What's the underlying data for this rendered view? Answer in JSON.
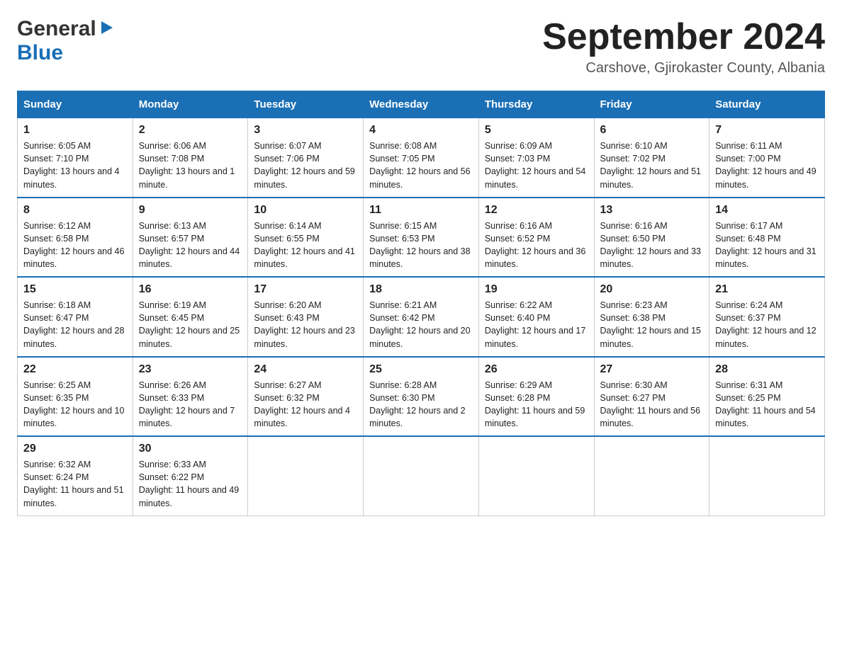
{
  "header": {
    "logo_general": "General",
    "logo_blue": "Blue",
    "month_title": "September 2024",
    "location": "Carshove, Gjirokaster County, Albania"
  },
  "days_of_week": [
    "Sunday",
    "Monday",
    "Tuesday",
    "Wednesday",
    "Thursday",
    "Friday",
    "Saturday"
  ],
  "weeks": [
    [
      {
        "day": "1",
        "sunrise": "6:05 AM",
        "sunset": "7:10 PM",
        "daylight": "13 hours and 4 minutes."
      },
      {
        "day": "2",
        "sunrise": "6:06 AM",
        "sunset": "7:08 PM",
        "daylight": "13 hours and 1 minute."
      },
      {
        "day": "3",
        "sunrise": "6:07 AM",
        "sunset": "7:06 PM",
        "daylight": "12 hours and 59 minutes."
      },
      {
        "day": "4",
        "sunrise": "6:08 AM",
        "sunset": "7:05 PM",
        "daylight": "12 hours and 56 minutes."
      },
      {
        "day": "5",
        "sunrise": "6:09 AM",
        "sunset": "7:03 PM",
        "daylight": "12 hours and 54 minutes."
      },
      {
        "day": "6",
        "sunrise": "6:10 AM",
        "sunset": "7:02 PM",
        "daylight": "12 hours and 51 minutes."
      },
      {
        "day": "7",
        "sunrise": "6:11 AM",
        "sunset": "7:00 PM",
        "daylight": "12 hours and 49 minutes."
      }
    ],
    [
      {
        "day": "8",
        "sunrise": "6:12 AM",
        "sunset": "6:58 PM",
        "daylight": "12 hours and 46 minutes."
      },
      {
        "day": "9",
        "sunrise": "6:13 AM",
        "sunset": "6:57 PM",
        "daylight": "12 hours and 44 minutes."
      },
      {
        "day": "10",
        "sunrise": "6:14 AM",
        "sunset": "6:55 PM",
        "daylight": "12 hours and 41 minutes."
      },
      {
        "day": "11",
        "sunrise": "6:15 AM",
        "sunset": "6:53 PM",
        "daylight": "12 hours and 38 minutes."
      },
      {
        "day": "12",
        "sunrise": "6:16 AM",
        "sunset": "6:52 PM",
        "daylight": "12 hours and 36 minutes."
      },
      {
        "day": "13",
        "sunrise": "6:16 AM",
        "sunset": "6:50 PM",
        "daylight": "12 hours and 33 minutes."
      },
      {
        "day": "14",
        "sunrise": "6:17 AM",
        "sunset": "6:48 PM",
        "daylight": "12 hours and 31 minutes."
      }
    ],
    [
      {
        "day": "15",
        "sunrise": "6:18 AM",
        "sunset": "6:47 PM",
        "daylight": "12 hours and 28 minutes."
      },
      {
        "day": "16",
        "sunrise": "6:19 AM",
        "sunset": "6:45 PM",
        "daylight": "12 hours and 25 minutes."
      },
      {
        "day": "17",
        "sunrise": "6:20 AM",
        "sunset": "6:43 PM",
        "daylight": "12 hours and 23 minutes."
      },
      {
        "day": "18",
        "sunrise": "6:21 AM",
        "sunset": "6:42 PM",
        "daylight": "12 hours and 20 minutes."
      },
      {
        "day": "19",
        "sunrise": "6:22 AM",
        "sunset": "6:40 PM",
        "daylight": "12 hours and 17 minutes."
      },
      {
        "day": "20",
        "sunrise": "6:23 AM",
        "sunset": "6:38 PM",
        "daylight": "12 hours and 15 minutes."
      },
      {
        "day": "21",
        "sunrise": "6:24 AM",
        "sunset": "6:37 PM",
        "daylight": "12 hours and 12 minutes."
      }
    ],
    [
      {
        "day": "22",
        "sunrise": "6:25 AM",
        "sunset": "6:35 PM",
        "daylight": "12 hours and 10 minutes."
      },
      {
        "day": "23",
        "sunrise": "6:26 AM",
        "sunset": "6:33 PM",
        "daylight": "12 hours and 7 minutes."
      },
      {
        "day": "24",
        "sunrise": "6:27 AM",
        "sunset": "6:32 PM",
        "daylight": "12 hours and 4 minutes."
      },
      {
        "day": "25",
        "sunrise": "6:28 AM",
        "sunset": "6:30 PM",
        "daylight": "12 hours and 2 minutes."
      },
      {
        "day": "26",
        "sunrise": "6:29 AM",
        "sunset": "6:28 PM",
        "daylight": "11 hours and 59 minutes."
      },
      {
        "day": "27",
        "sunrise": "6:30 AM",
        "sunset": "6:27 PM",
        "daylight": "11 hours and 56 minutes."
      },
      {
        "day": "28",
        "sunrise": "6:31 AM",
        "sunset": "6:25 PM",
        "daylight": "11 hours and 54 minutes."
      }
    ],
    [
      {
        "day": "29",
        "sunrise": "6:32 AM",
        "sunset": "6:24 PM",
        "daylight": "11 hours and 51 minutes."
      },
      {
        "day": "30",
        "sunrise": "6:33 AM",
        "sunset": "6:22 PM",
        "daylight": "11 hours and 49 minutes."
      },
      null,
      null,
      null,
      null,
      null
    ]
  ]
}
